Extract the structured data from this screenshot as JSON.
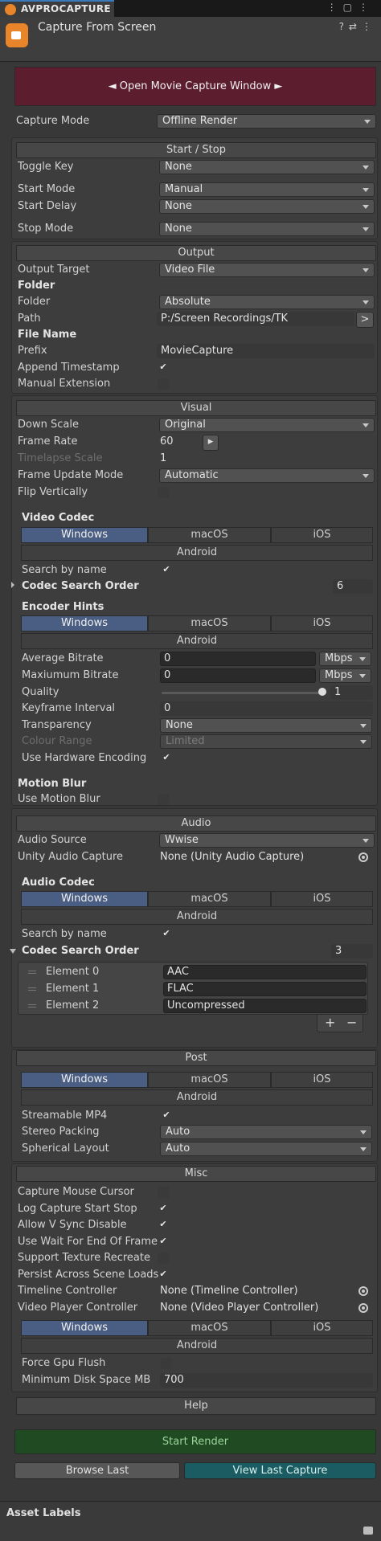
{
  "window": {
    "tab_title": "AVPROCAPTURE",
    "component_title": "Capture From Screen"
  },
  "open_window_button": "◄ Open Movie Capture Window ►",
  "capture_mode": {
    "label": "Capture Mode",
    "value": "Offline Render"
  },
  "start_stop": {
    "header": "Start / Stop",
    "toggle_key_label": "Toggle Key",
    "toggle_key": "None",
    "start_mode_label": "Start Mode",
    "start_mode": "Manual",
    "start_delay_label": "Start Delay",
    "start_delay": "None",
    "stop_mode_label": "Stop Mode",
    "stop_mode": "None"
  },
  "output": {
    "header": "Output",
    "target_label": "Output Target",
    "target": "Video File",
    "folder_heading": "Folder",
    "folder_label": "Folder",
    "folder": "Absolute",
    "path_label": "Path",
    "path": "P:/Screen Recordings/TK",
    "browse": ">",
    "file_name_heading": "File Name",
    "prefix_label": "Prefix",
    "prefix": "MovieCapture",
    "append_timestamp_label": "Append Timestamp",
    "manual_extension_label": "Manual Extension"
  },
  "visual": {
    "header": "Visual",
    "down_scale_label": "Down Scale",
    "down_scale": "Original",
    "frame_rate_label": "Frame Rate",
    "frame_rate": "60",
    "frame_rate_btn": "▸",
    "timelapse_label": "Timelapse Scale",
    "timelapse": "1",
    "frame_update_label": "Frame Update Mode",
    "frame_update": "Automatic",
    "flip_label": "Flip Vertically",
    "video_codec_heading": "Video Codec",
    "search_by_name_label": "Search by name",
    "codec_search_order_label": "Codec Search Order",
    "codec_search_order": "6",
    "encoder_hints_heading": "Encoder Hints",
    "avg_bitrate_label": "Average Bitrate",
    "avg_bitrate": "0",
    "avg_bitrate_unit": "Mbps",
    "max_bitrate_label": "Maxiumum Bitrate",
    "max_bitrate": "0",
    "max_bitrate_unit": "Mbps",
    "quality_label": "Quality",
    "quality": "1",
    "quality_level": 1,
    "keyframe_label": "Keyframe Interval",
    "keyframe": "0",
    "transparency_label": "Transparency",
    "transparency": "None",
    "colour_range_label": "Colour Range",
    "colour_range": "Limited",
    "hw_encoding_label": "Use Hardware Encoding",
    "motion_blur_heading": "Motion Blur",
    "use_motion_blur_label": "Use Motion Blur"
  },
  "platforms": {
    "windows": "Windows",
    "macos": "macOS",
    "ios": "iOS",
    "android": "Android"
  },
  "audio": {
    "header": "Audio",
    "source_label": "Audio Source",
    "source": "Wwise",
    "unity_capture_label": "Unity Audio Capture",
    "unity_capture": "None (Unity Audio Capture)",
    "codec_heading": "Audio Codec",
    "search_by_name_label": "Search by name",
    "codec_search_order_label": "Codec Search Order",
    "codec_search_order": "3",
    "elements": [
      {
        "label": "Element 0",
        "value": "AAC"
      },
      {
        "label": "Element 1",
        "value": "FLAC"
      },
      {
        "label": "Element 2",
        "value": "Uncompressed"
      }
    ],
    "add": "+",
    "remove": "−"
  },
  "post": {
    "header": "Post",
    "streamable_label": "Streamable MP4",
    "stereo_label": "Stereo Packing",
    "stereo": "Auto",
    "spherical_label": "Spherical Layout",
    "spherical": "Auto"
  },
  "misc": {
    "header": "Misc",
    "mouse_cursor_label": "Capture Mouse Cursor",
    "log_label": "Log Capture Start Stop",
    "vsync_label": "Allow V Sync Disable",
    "wait_label": "Use Wait For End Of Frame",
    "texture_label": "Support Texture Recreate",
    "persist_label": "Persist Across Scene Loads",
    "timeline_label": "Timeline Controller",
    "timeline": "None (Timeline Controller)",
    "video_player_label": "Video Player Controller",
    "video_player": "None (Video Player Controller)",
    "gpu_flush_label": "Force Gpu Flush",
    "disk_label": "Minimum Disk Space MB",
    "disk": "700"
  },
  "help": "Help",
  "start_render": "Start Render",
  "browse_last": "Browse Last",
  "view_last": "View Last Capture",
  "asset_labels": "Asset Labels",
  "check": "✔"
}
